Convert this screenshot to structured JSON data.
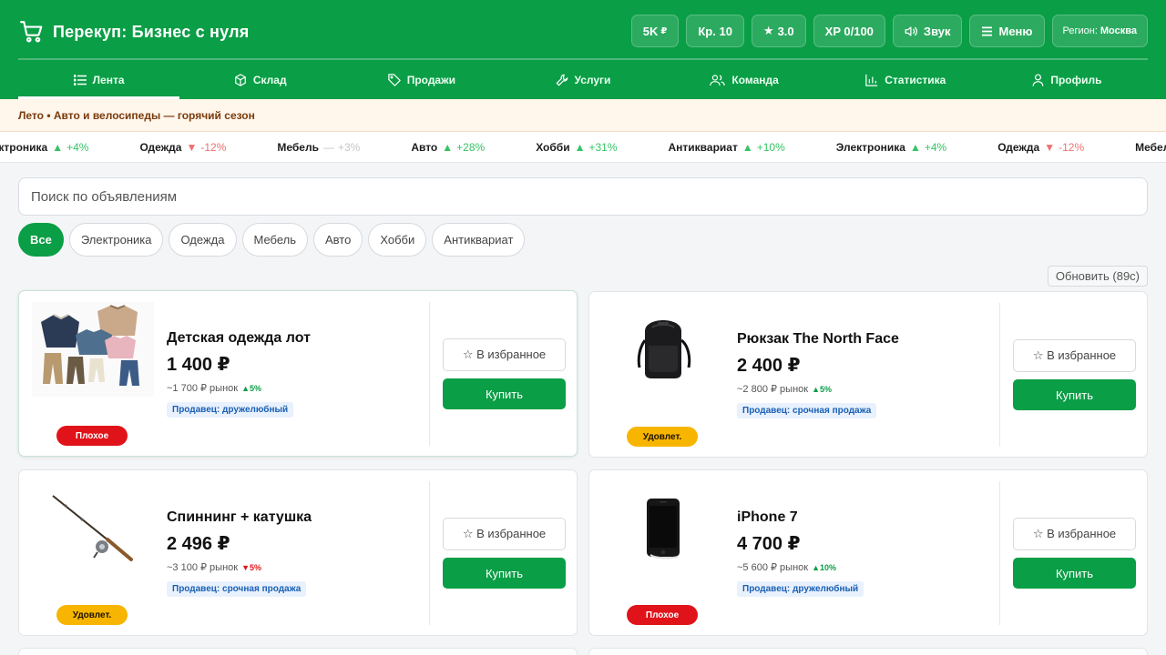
{
  "header": {
    "title": "Перекуп: Бизнес с нуля",
    "stats": {
      "money": "5K",
      "currency": "₽",
      "credit": "Кр. 10",
      "rating": "3.0",
      "xp": "XP 0/100",
      "sound": "Звук",
      "menu": "Меню",
      "region_label": "Регион:",
      "region_value": "Москва"
    },
    "accent": "#0a9e46"
  },
  "tabs": [
    {
      "label": "Лента",
      "icon": "list-icon",
      "active": true
    },
    {
      "label": "Склад",
      "icon": "box-icon"
    },
    {
      "label": "Продажи",
      "icon": "tag-icon"
    },
    {
      "label": "Услуги",
      "icon": "wrench-icon"
    },
    {
      "label": "Команда",
      "icon": "team-icon"
    },
    {
      "label": "Статистика",
      "icon": "chart-icon"
    },
    {
      "label": "Профиль",
      "icon": "user-icon"
    }
  ],
  "season": "Лето • Авто и велосипеды — горячий сезон",
  "ticker": [
    {
      "name": "Электроника",
      "arrow": "▲",
      "change": "+4%",
      "dir": "up"
    },
    {
      "name": "Одежда",
      "arrow": "▼",
      "change": "-12%",
      "dir": "down"
    },
    {
      "name": "Мебель",
      "arrow": "—",
      "change": "+3%",
      "dir": "flat"
    },
    {
      "name": "Авто",
      "arrow": "▲",
      "change": "+28%",
      "dir": "up"
    },
    {
      "name": "Хобби",
      "arrow": "▲",
      "change": "+31%",
      "dir": "up"
    },
    {
      "name": "Антиквариат",
      "arrow": "▲",
      "change": "+10%",
      "dir": "up"
    },
    {
      "name": "Электроника",
      "arrow": "▲",
      "change": "+4%",
      "dir": "up"
    },
    {
      "name": "Одежда",
      "arrow": "▼",
      "change": "-12%",
      "dir": "down"
    },
    {
      "name": "Мебель",
      "arrow": "",
      "change": "",
      "dir": "flat"
    }
  ],
  "search": {
    "placeholder": "Поиск по объявлениям"
  },
  "filters": [
    "Все",
    "Электроника",
    "Одежда",
    "Мебель",
    "Авто",
    "Хобби",
    "Антиквариат"
  ],
  "refresh": "Обновить (89с)",
  "listings": [
    {
      "title": "Детская одежда лот",
      "price": "1 400 ₽",
      "market": "~1 700 ₽ рынок",
      "trend": "▲5%",
      "trend_dir": "up",
      "seller": "Продавец: дружелюбный",
      "condition": "Плохое",
      "cond_type": "bad",
      "image": "kids-clothes",
      "fav": "☆ В избранное",
      "buy": "Купить"
    },
    {
      "title": "Рюкзак The North Face",
      "price": "2 400 ₽",
      "market": "~2 800 ₽ рынок",
      "trend": "▲5%",
      "trend_dir": "up",
      "seller": "Продавец: срочная продажа",
      "condition": "Удовлет.",
      "cond_type": "ok",
      "image": "backpack",
      "fav": "☆ В избранное",
      "buy": "Купить"
    },
    {
      "title": "Спиннинг + катушка",
      "price": "2 496 ₽",
      "market": "~3 100 ₽ рынок",
      "trend": "▼5%",
      "trend_dir": "down",
      "seller": "Продавец: срочная продажа",
      "condition": "Удовлет.",
      "cond_type": "ok",
      "image": "fishing-rod",
      "fav": "☆ В избранное",
      "buy": "Купить"
    },
    {
      "title": "iPhone 7",
      "price": "4 700 ₽",
      "market": "~5 600 ₽ рынок",
      "trend": "▲10%",
      "trend_dir": "up",
      "seller": "Продавец: дружелюбный",
      "condition": "Плохое",
      "cond_type": "bad",
      "image": "iphone",
      "fav": "☆ В избранное",
      "buy": "Купить"
    }
  ]
}
